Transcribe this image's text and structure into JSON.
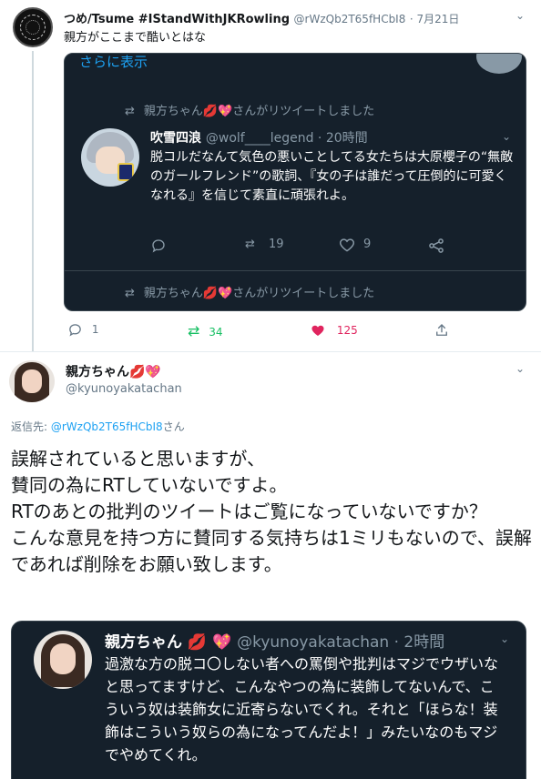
{
  "top_tweet": {
    "display_name": "つめ/Tsume #IStandWithJKRowling",
    "handle": "@rWzQb2T65fHCbI8",
    "date": "· 7月21日",
    "caret": "⌄",
    "text": "親方がここまで酷いとはな",
    "actions": {
      "reply_count": "1",
      "retweet_count": "34",
      "like_count": "125"
    }
  },
  "embedded_card": {
    "show_more": "さらに表示",
    "retweet_note": "親方ちゃん💋💖さんがリツイートしました",
    "inner_tweet": {
      "name": "吹雪四浪",
      "handle": "@wolf____legend · 20時間",
      "text": "脱コルだなんて気色の悪いことしてる女たちは大原櫻子の“無敵のガールフレンド”の歌詞、『女の子は誰だって圧倒的に可愛くなれる』を信じて素直に頑張れよ。",
      "retweet_count": "19",
      "like_count": "9"
    },
    "retweet_note_2": "親方ちゃん💋💖さんがリツイートしました"
  },
  "reply_tweet": {
    "display_name": "親方ちゃん💋💖",
    "handle": "@kyunoyakatachan",
    "reply_to_label": "返信先:",
    "reply_to_handle": "@rWzQb2T65fHCbI8",
    "reply_to_suffix": "さん",
    "body": "誤解されていると思いますが、\n賛同の為にRTしていないですよ。\nRTのあとの批判のツイートはご覧になっていないですか？\nこんな意見を持つ方に賛同する気持ちは1ミリもないので、誤解であれば削除をお願い致します。"
  },
  "quoted_tweet": {
    "name": "親方ちゃん 💋 💖",
    "handle": "@kyunoyakatachan · 2時間",
    "text": "過激な方の脱コ〇しない者への罵倒や批判はマジでウザいなと思ってますけど、こんなやつの為に装飾してないんで、こういう奴は装飾女に近寄らないでくれ。それと「ほらな！装飾はこういう奴らの為になってんだよ！」みたいなのもマジでやめてくれ。"
  },
  "icons": {
    "reply": "reply-icon",
    "retweet": "retweet-icon",
    "like": "heart-icon",
    "share": "share-icon"
  },
  "colors": {
    "accent": "#1da1f2",
    "retweet_green": "#17bf63",
    "like_red": "#e0245e",
    "dark_bg": "#15202b"
  }
}
